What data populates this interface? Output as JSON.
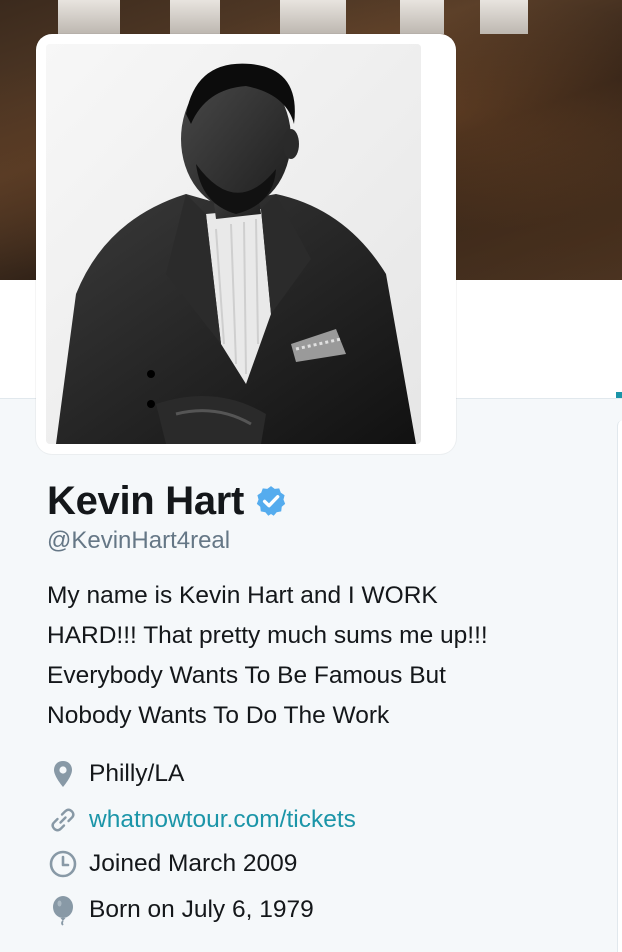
{
  "profile": {
    "display_name": "Kevin Hart",
    "handle": "@KevinHart4real",
    "verified": true,
    "bio_lines": [
      "My name is Kevin Hart and I WORK",
      "HARD!!! That pretty much sums me up!!!",
      "Everybody Wants To Be Famous But",
      "Nobody Wants To Do The Work"
    ],
    "location": "Philly/LA",
    "website": "whatnowtour.com/tickets",
    "joined": "Joined March 2009",
    "born": "Born on July 6, 1979"
  },
  "icons": {
    "verified": "verified-badge-icon",
    "location": "location-pin-icon",
    "website": "link-icon",
    "joined": "calendar-clock-icon",
    "born": "balloon-icon"
  },
  "colors": {
    "link": "#1b95a8",
    "verified": "#55acee",
    "secondary_text": "#657786",
    "primary_text": "#14171a",
    "background": "#f5f8fa"
  }
}
